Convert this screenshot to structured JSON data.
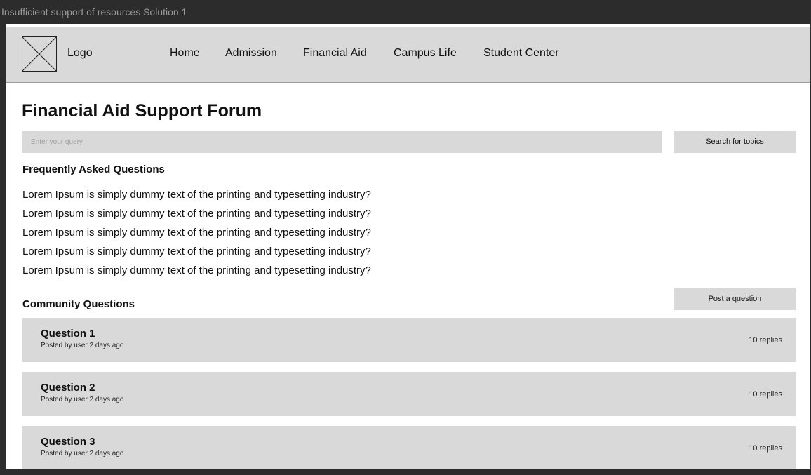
{
  "window": {
    "title": "Insufficient support of resources Solution 1"
  },
  "navbar": {
    "logo_icon": "image-placeholder-icon",
    "logo_label": "Logo",
    "links": [
      {
        "label": "Home"
      },
      {
        "label": "Admission"
      },
      {
        "label": "Financial Aid"
      },
      {
        "label": "Campus Life"
      },
      {
        "label": "Student Center"
      }
    ]
  },
  "page": {
    "title": "Financial Aid Support Forum"
  },
  "search": {
    "placeholder": "Enter your query",
    "value": "",
    "button_label": "Search for topics"
  },
  "faq": {
    "heading": "Frequently Asked Questions",
    "items": [
      "Lorem Ipsum is simply dummy text of the printing and typesetting industry?",
      "Lorem Ipsum is simply dummy text of the printing and typesetting industry?",
      "Lorem Ipsum is simply dummy text of the printing and typesetting industry?",
      "Lorem Ipsum is simply dummy text of the printing and typesetting industry?",
      "Lorem Ipsum is simply dummy text of the printing and typesetting industry?"
    ]
  },
  "community": {
    "heading": "Community Questions",
    "post_button_label": "Post a question",
    "questions": [
      {
        "title": "Question 1",
        "meta": "Posted by user 2 days ago",
        "replies": "10 replies"
      },
      {
        "title": "Question 2",
        "meta": "Posted by user 2 days ago",
        "replies": "10 replies"
      },
      {
        "title": "Question 3",
        "meta": "Posted by user 2 days ago",
        "replies": "10 replies"
      }
    ]
  },
  "colors": {
    "background": "#2c2c2c",
    "surface": "#ffffff",
    "panel": "#d9d9d9",
    "text": "#111111"
  }
}
